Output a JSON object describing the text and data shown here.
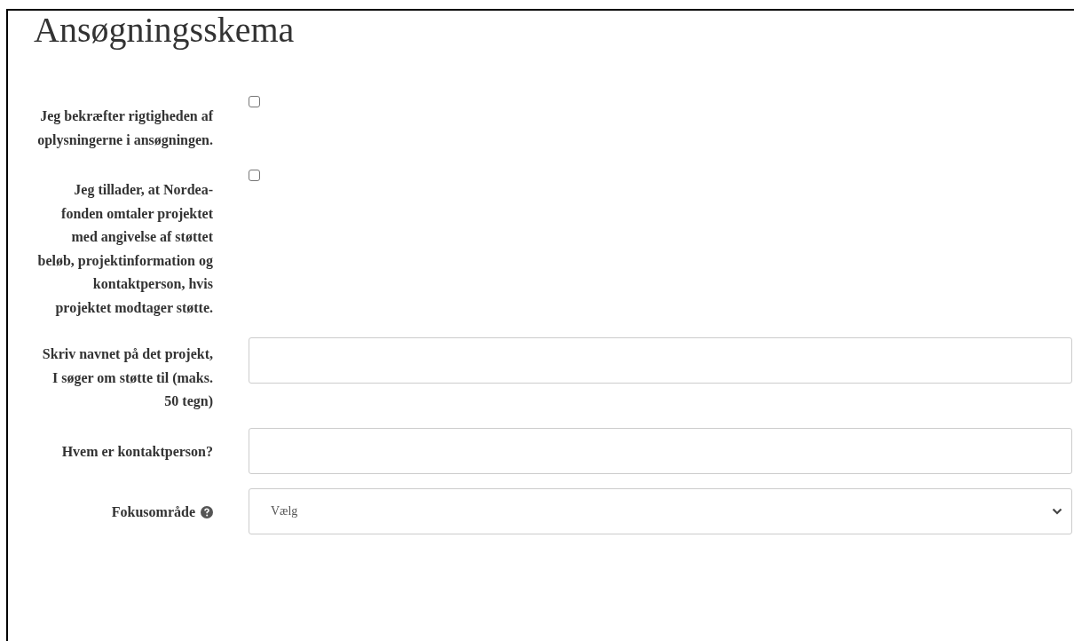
{
  "form": {
    "title": "Ansøgningsskema",
    "fields": [
      {
        "kind": "checkbox",
        "label": "Jeg bekræfter rigtigheden af oplysningerne i ansøgningen.",
        "checked": false
      },
      {
        "kind": "checkbox",
        "label": "Jeg tillader, at Nordea-fonden omtaler projektet med angivelse af støttet beløb, projektinformation og kontaktperson, hvis projektet modtager støtte.",
        "checked": false
      },
      {
        "kind": "text",
        "label": "Skriv navnet på det projekt, I søger om støtte til (maks. 50 tegn)"
      },
      {
        "kind": "text",
        "label": "Hvem er kontaktperson?"
      },
      {
        "kind": "select",
        "label": "Fokusområde",
        "help": true,
        "value": "Vælg"
      }
    ]
  }
}
